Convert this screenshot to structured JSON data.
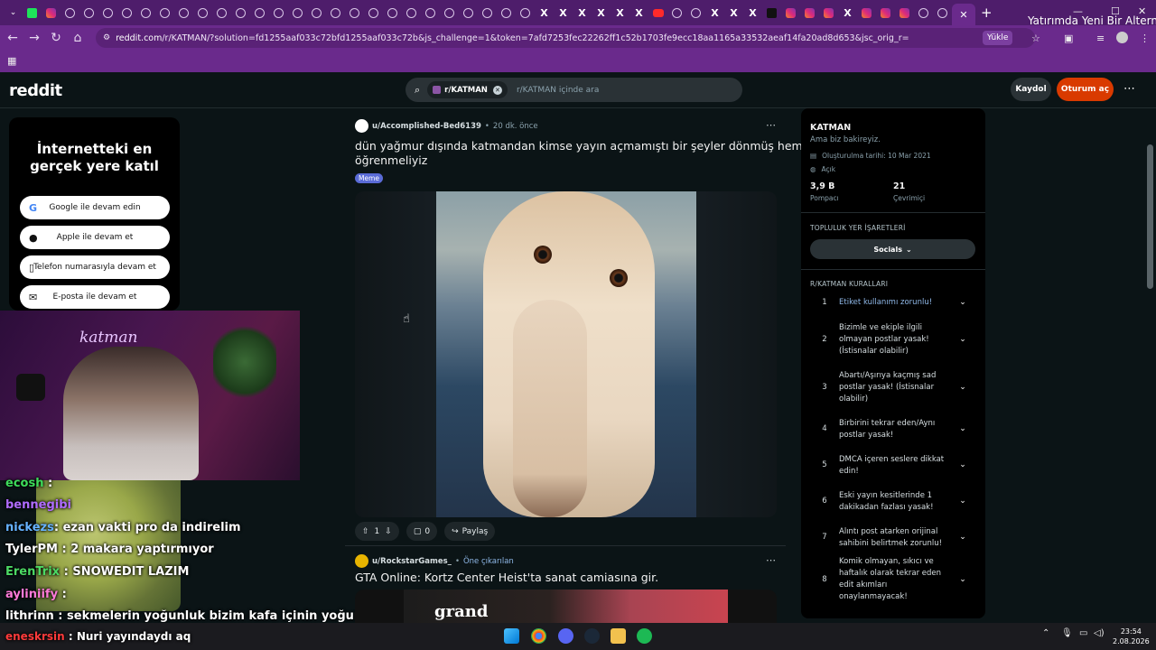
{
  "browser": {
    "tab_title": "Yatırımda Yeni Bir Alternatif",
    "url_host": "reddit.com",
    "url_path": "/r/KATMAN/?solution=fd1255aaf033c72bfd1255aaf033c72b&js_challenge=1&token=7afd7253fec22262ff1c52b1703fe9ecc18aa1165a33532aeaf14fa20ad8d653&jsc_orig_r=",
    "load_button": "Yükle"
  },
  "header": {
    "logo": "reddit",
    "search_chip": "r/KATMAN",
    "search_placeholder": "r/KATMAN içinde ara",
    "signup": "Kaydol",
    "login": "Oturum aç"
  },
  "signin_card": {
    "title": "İnternetteki en gerçek yere katıl",
    "buttons": [
      {
        "label": "Google ile devam edin",
        "icon": "google-icon"
      },
      {
        "label": "Apple ile devam et",
        "icon": "apple-icon"
      },
      {
        "label": "Telefon numarasıyla devam et",
        "icon": "phone-icon"
      },
      {
        "label": "E-posta ile devam et",
        "icon": "mail-icon"
      }
    ]
  },
  "stream": {
    "neon_sign": "katman",
    "chat": [
      {
        "user": "ecosh",
        "msg": "",
        "color": "#3ddc5a"
      },
      {
        "user": "bennegibi",
        "msg": "",
        "color": "#b06cff"
      },
      {
        "user": "nickezs",
        "msg": "ezan vakti pro da indirelim",
        "color": "#66b2ff"
      },
      {
        "user": "TylerPM",
        "msg": "2 makara yaptırmıyor",
        "color": "#ffffff"
      },
      {
        "user": "ErenTrix",
        "msg": "SNOWEDIT LAZIM",
        "color": "#4cd964"
      },
      {
        "user": "ayliniify",
        "msg": "",
        "color": "#ff7ad9"
      },
      {
        "user": "lithrinn",
        "msg": "sekmelerin yoğunluk bizim kafa içinin yoğunluk",
        "color": "#ffffff"
      },
      {
        "user": "eneskrsin",
        "msg": "Nuri yayındaydı aq",
        "color": "#ff3b3b"
      }
    ]
  },
  "post1": {
    "author": "u/Accomplished-Bed6139",
    "time": "20 dk. önce",
    "title_line1": "dün yağmur dışında katmandan kimse yayın açmamıştı bir şeyler dönmüş hemen",
    "title_line2": "öğrenmeliyiz",
    "flair": "Meme",
    "votes": "1",
    "comments": "0",
    "share": "Paylaş"
  },
  "post2": {
    "author": "u/RockstarGames_",
    "tag": "Öne çıkarılan",
    "title": "GTA Online: Kortz Center Heist'ta sanat camiasına gir.",
    "image_text": "grand"
  },
  "sidebar": {
    "name": "KATMAN",
    "desc": "Ama biz bakireyiz.",
    "created": "Oluşturulma tarihi: 10 Mar 2021",
    "status": "Açık",
    "members_value": "3,9 B",
    "members_label": "Pompacı",
    "online_value": "21",
    "online_label": "Çevrimiçi",
    "bookmarks_heading": "TOPLULUK YER İŞARETLERİ",
    "socials": "Socials",
    "rules_heading": "R/KATMAN KURALLARI",
    "rules": [
      {
        "n": "1",
        "t": "Etiket kullanımı zorunlu!"
      },
      {
        "n": "2",
        "t": "Bizimle ve ekiple ilgili olmayan postlar yasak! (İstisnalar olabilir)"
      },
      {
        "n": "3",
        "t": "Abartı/Aşırıya kaçmış sad postlar yasak! (İstisnalar olabilir)"
      },
      {
        "n": "4",
        "t": "Birbirini tekrar eden/Aynı postlar yasak!"
      },
      {
        "n": "5",
        "t": "DMCA içeren seslere dikkat edin!"
      },
      {
        "n": "6",
        "t": "Eski yayın kesitlerinde 1 dakikadan fazlası yasak!"
      },
      {
        "n": "7",
        "t": "Alıntı post atarken orijinal sahibini belirtmek zorunlu!"
      },
      {
        "n": "8",
        "t": "Komik olmayan, sıkıcı ve haftalık olarak tekrar eden edit akımları onaylanmayacak!"
      }
    ]
  },
  "taskbar": {
    "time": "23:54",
    "date": "2.08.2026"
  },
  "colors": {
    "accent": "#d93a00",
    "browser": "#6a2a8c",
    "bg": "#0b1416"
  }
}
